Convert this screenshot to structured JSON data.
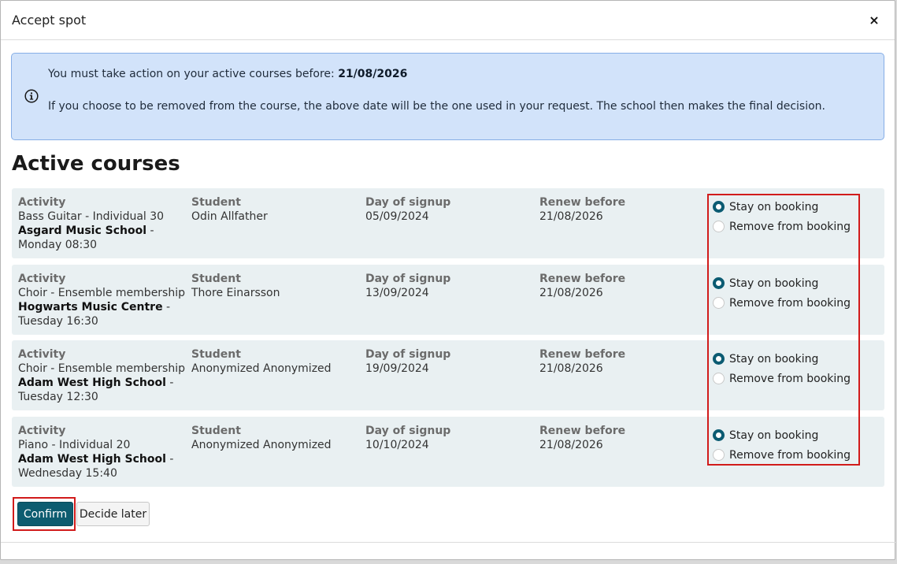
{
  "modal": {
    "title": "Accept spot",
    "close_label": "×"
  },
  "alert": {
    "line1_prefix": "You must take action on your active courses before:",
    "line1_date": "21/08/2026",
    "line2": "If you choose to be removed from the course, the above date will be the one used in your request. The school then makes the final decision."
  },
  "section": {
    "title": "Active courses"
  },
  "columns": {
    "activity": "Activity",
    "student": "Student",
    "signup": "Day of signup",
    "renew": "Renew before"
  },
  "options": {
    "stay": "Stay on booking",
    "remove": "Remove from booking"
  },
  "courses": [
    {
      "activity": "Bass Guitar - Individual 30",
      "school": "Asgard Music School",
      "schedule": " - Monday 08:30",
      "student": "Odin Allfather",
      "signup": "05/09/2024",
      "renew": "21/08/2026",
      "selected": "stay"
    },
    {
      "activity": "Choir - Ensemble membership",
      "school": "Hogwarts Music Centre",
      "schedule": " - Tuesday 16:30",
      "student": "Thore Einarsson",
      "signup": "13/09/2024",
      "renew": "21/08/2026",
      "selected": "stay"
    },
    {
      "activity": "Choir - Ensemble membership",
      "school": "Adam West High School",
      "schedule": " - Tuesday 12:30",
      "student": "Anonymized Anonymized",
      "signup": "19/09/2024",
      "renew": "21/08/2026",
      "selected": "stay"
    },
    {
      "activity": "Piano - Individual 20",
      "school": "Adam West High School",
      "schedule": " - Wednesday 15:40",
      "student": "Anonymized Anonymized",
      "signup": "10/10/2024",
      "renew": "21/08/2026",
      "selected": "stay"
    }
  ],
  "buttons": {
    "confirm": "Confirm",
    "decide_later": "Decide later"
  },
  "colors": {
    "primary": "#0d5c70",
    "alert_bg": "#d2e3fa",
    "row_bg": "#e9f0f2",
    "highlight": "#d11b1b"
  }
}
